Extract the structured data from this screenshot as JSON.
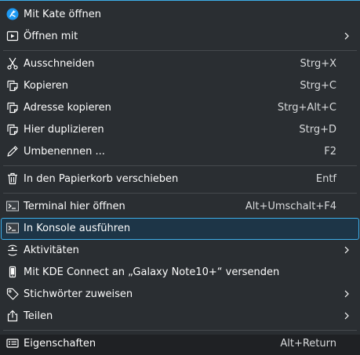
{
  "menu": {
    "items": [
      {
        "label": "Mit Kate öffnen",
        "icon": "kate-icon"
      },
      {
        "label": "Öffnen mit",
        "icon": "open-with-icon"
      },
      {
        "label": "Ausschneiden",
        "shortcut": "Strg+X",
        "icon": "scissors-icon"
      },
      {
        "label": "Kopieren",
        "shortcut": "Strg+C",
        "icon": "copy-icon"
      },
      {
        "label": "Adresse kopieren",
        "shortcut": "Strg+Alt+C",
        "icon": "copy-icon"
      },
      {
        "label": "Hier duplizieren",
        "shortcut": "Strg+D",
        "icon": "copy-icon"
      },
      {
        "label": "Umbenennen ...",
        "shortcut": "F2",
        "icon": "pencil-icon"
      },
      {
        "label": "In den Papierkorb verschieben",
        "shortcut": "Entf",
        "icon": "trash-icon"
      },
      {
        "label": "Terminal hier öffnen",
        "shortcut": "Alt+Umschalt+F4",
        "icon": "terminal-icon"
      },
      {
        "label": "In Konsole ausführen",
        "icon": "terminal-icon"
      },
      {
        "label": "Aktivitäten",
        "icon": "activities-icon"
      },
      {
        "label": "Mit KDE Connect an „Galaxy Note10+“ versenden",
        "icon": "phone-icon"
      },
      {
        "label": "Stichwörter zuweisen",
        "icon": "tag-icon"
      },
      {
        "label": "Teilen",
        "icon": "share-icon"
      },
      {
        "label": "Eigenschaften",
        "shortcut": "Alt+Return",
        "icon": "properties-icon"
      }
    ]
  },
  "colors": {
    "background": "#2a2e32",
    "highlight": "#3daee9",
    "highlight_fill": "#1d3547",
    "text": "#fcfcfc"
  }
}
